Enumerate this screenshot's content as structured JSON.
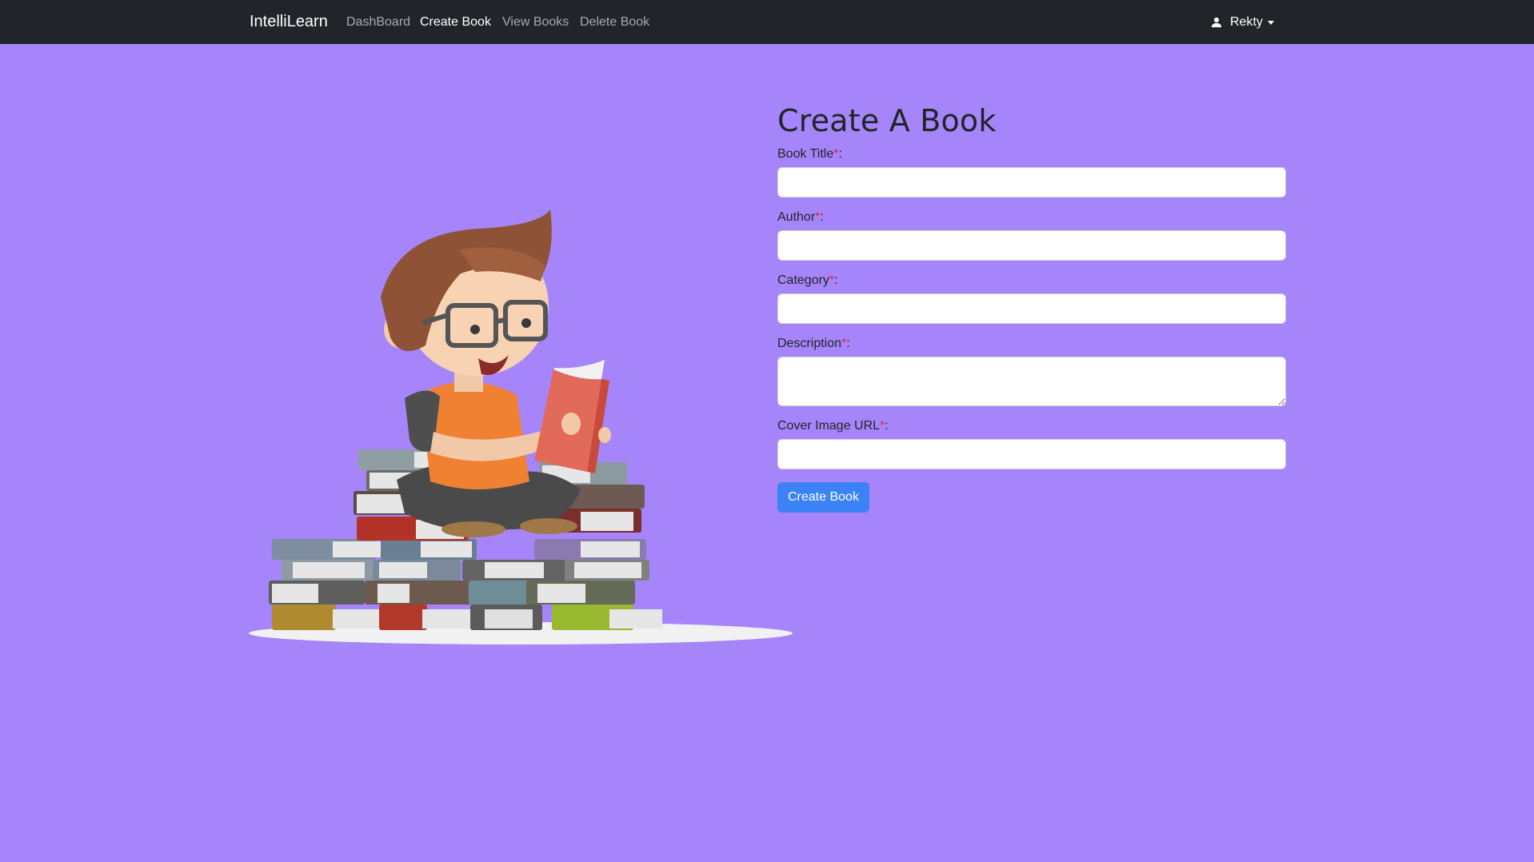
{
  "navbar": {
    "brand": "IntelliLearn",
    "links": [
      {
        "label": "DashBoard"
      },
      {
        "label": "Create Book"
      },
      {
        "label": "View Books"
      },
      {
        "label": "Delete Book"
      }
    ],
    "user": {
      "name": "Rekty",
      "icon": "user-icon"
    }
  },
  "illustration": {
    "icon": "student-reading-on-books-illustration"
  },
  "form": {
    "title": "Create A Book",
    "required_marker": "*",
    "fields": [
      {
        "label": "Book Title",
        "value": ""
      },
      {
        "label": "Author",
        "value": ""
      },
      {
        "label": "Category",
        "value": ""
      },
      {
        "label": "Description",
        "value": ""
      },
      {
        "label": "Cover Image URL",
        "value": ""
      }
    ],
    "submit_label": "Create Book"
  },
  "colors": {
    "background": "#a685fa",
    "navbar": "#212529",
    "primary_button": "#3b82f6",
    "required": "#e4263b"
  }
}
